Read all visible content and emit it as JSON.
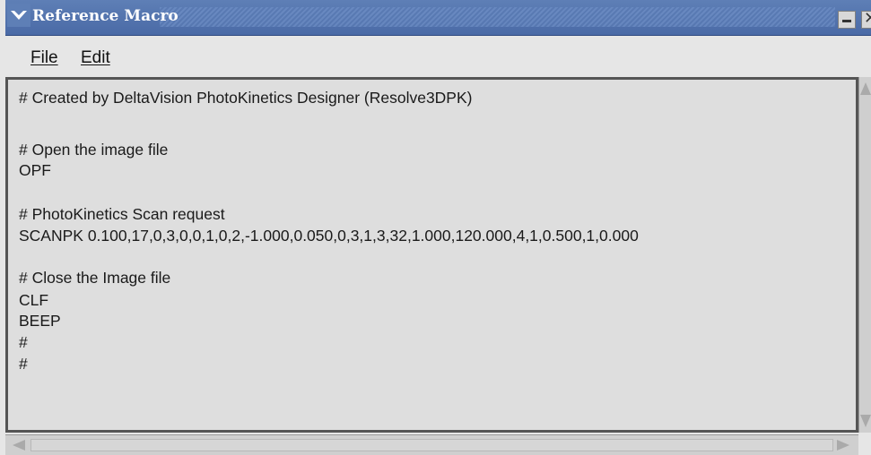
{
  "window": {
    "title": "Reference Macro",
    "menu_icon": "chevron-down-icon",
    "minimize_icon": "minimize-icon",
    "close_icon": "close-icon",
    "close_glyph": "✕"
  },
  "menu": {
    "file_label": "File",
    "edit_label": "Edit"
  },
  "editor": {
    "lines": [
      "# Created by DeltaVision PhotoKinetics Designer (Resolve3DPK)",
      "",
      "# Open the image file",
      "OPF",
      "",
      "# PhotoKinetics Scan request",
      "SCANPK 0.100,17,0,3,0,0,1,0,2,-1.000,0.050,0,3,1,3,32,1.000,120.000,4,1,0.500,1,0.000",
      "",
      "# Close the Image file",
      "CLF",
      "BEEP",
      "#",
      "#"
    ]
  },
  "colors": {
    "titlebar": "#4a6aa6",
    "background": "#e6e6e6",
    "editor_bg": "#dedede"
  }
}
